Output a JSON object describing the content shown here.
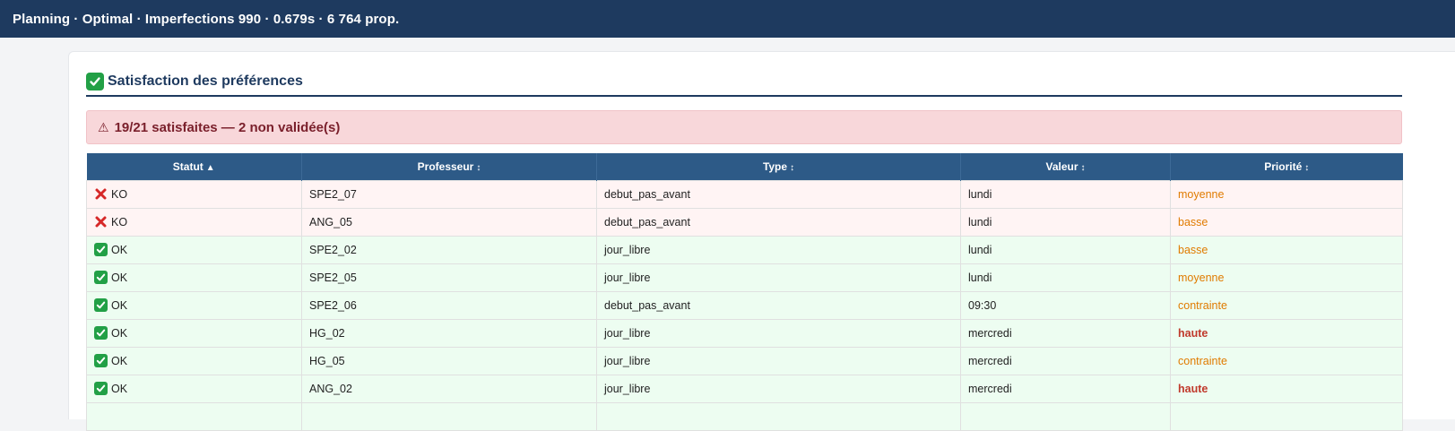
{
  "header": {
    "title": "Planning · Optimal · Imperfections 990 · 0.679s · 6 764 prop."
  },
  "section": {
    "icon": "check-mark-icon",
    "title": "Satisfaction des préférences"
  },
  "alert": {
    "icon": "warning-icon",
    "text": "19/21 satisfaites — 2 non validée(s)"
  },
  "table": {
    "columns": [
      {
        "label": "Statut",
        "sort": "▲"
      },
      {
        "label": "Professeur",
        "sort": "↕"
      },
      {
        "label": "Type",
        "sort": "↕"
      },
      {
        "label": "Valeur",
        "sort": "↕"
      },
      {
        "label": "Priorité",
        "sort": "↕"
      }
    ],
    "rows": [
      {
        "status": "KO",
        "prof": "SPE2_07",
        "type": "debut_pas_avant",
        "valeur": "lundi",
        "priorite": "moyenne"
      },
      {
        "status": "KO",
        "prof": "ANG_05",
        "type": "debut_pas_avant",
        "valeur": "lundi",
        "priorite": "basse"
      },
      {
        "status": "OK",
        "prof": "SPE2_02",
        "type": "jour_libre",
        "valeur": "lundi",
        "priorite": "basse"
      },
      {
        "status": "OK",
        "prof": "SPE2_05",
        "type": "jour_libre",
        "valeur": "lundi",
        "priorite": "moyenne"
      },
      {
        "status": "OK",
        "prof": "SPE2_06",
        "type": "debut_pas_avant",
        "valeur": "09:30",
        "priorite": "contrainte"
      },
      {
        "status": "OK",
        "prof": "HG_02",
        "type": "jour_libre",
        "valeur": "mercredi",
        "priorite": "haute"
      },
      {
        "status": "OK",
        "prof": "HG_05",
        "type": "jour_libre",
        "valeur": "mercredi",
        "priorite": "contrainte"
      },
      {
        "status": "OK",
        "prof": "ANG_02",
        "type": "jour_libre",
        "valeur": "mercredi",
        "priorite": "haute"
      },
      {
        "status": "",
        "prof": "",
        "type": "",
        "valeur": "",
        "priorite": ""
      }
    ]
  },
  "colors": {
    "header_bg": "#1e3a5f",
    "table_header_bg": "#2d5a87",
    "ok_row_bg": "#edfdf1",
    "ko_row_bg": "#fff4f4",
    "alert_bg": "#f8d7da",
    "priority_orange": "#e07b00",
    "priority_red": "#c0392b"
  }
}
